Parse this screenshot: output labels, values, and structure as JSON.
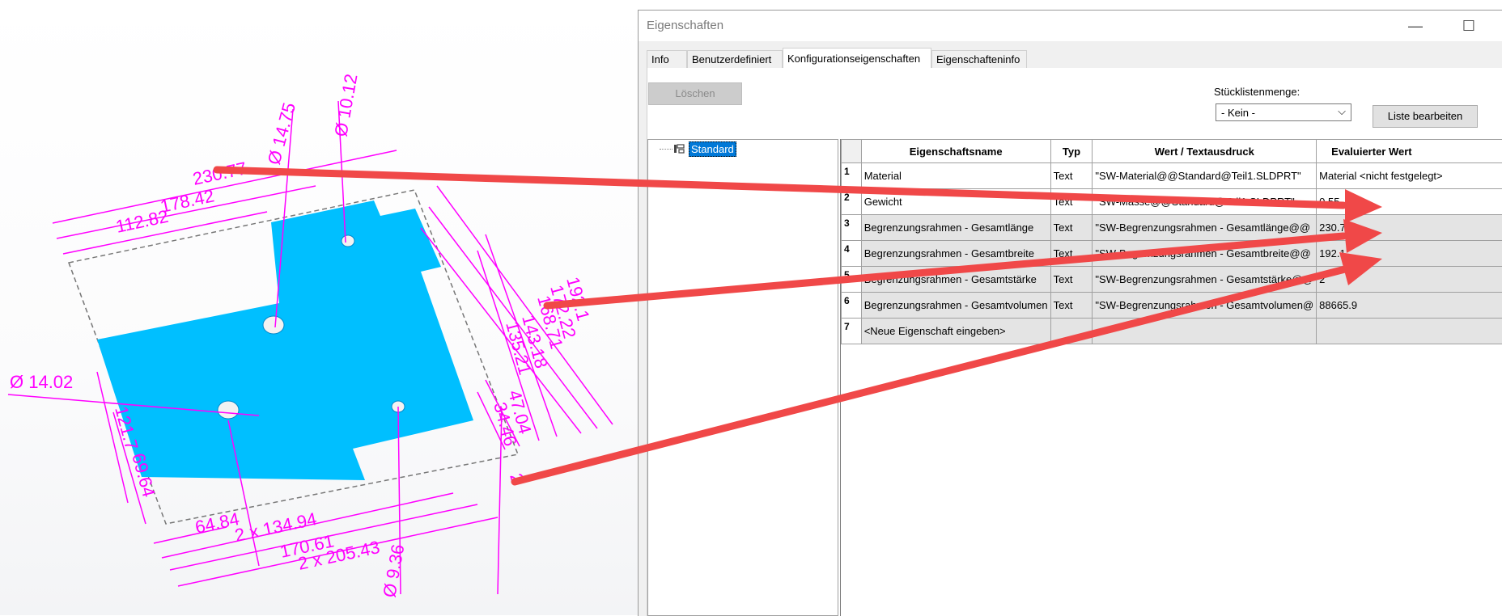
{
  "cad": {
    "dimensions": [
      "Ø 14.75",
      "Ø 10.12",
      "230.77",
      "178.42",
      "112.82",
      "Ø 14.02",
      "192.1",
      "172.22",
      "168.71",
      "143.18",
      "135.21",
      "47.04",
      "34.46",
      "121.7",
      "69.64",
      "64.84",
      "2 x 134.94",
      "170.61",
      "2 x 205.43",
      "Ø 9.36",
      "2"
    ]
  },
  "dialog": {
    "title": "Eigenschaften",
    "window_buttons": {
      "minimize": "—",
      "maximize": "☐",
      "close": "✕"
    },
    "tabs": [
      {
        "label": "Info"
      },
      {
        "label": "Benutzerdefiniert"
      },
      {
        "label": "Konfigurationseigenschaften",
        "active": true
      },
      {
        "label": "Eigenschafteninfo"
      }
    ],
    "delete_label": "Löschen",
    "bom_label": "Stücklistenmenge:",
    "bom_value": "- Kein -",
    "edit_list_label": "Liste bearbeiten",
    "tree": {
      "config_name": "Standard"
    },
    "grid": {
      "headers": [
        "Eigenschaftsname",
        "Typ",
        "Wert / Textausdruck",
        "Evaluierter Wert"
      ],
      "rows": [
        {
          "num": "1",
          "name": "Material",
          "type": "Text",
          "expr": "\"SW-Material@@Standard@Teil1.SLDPRT\"",
          "value": "Material <nicht festgelegt>"
        },
        {
          "num": "2",
          "name": "Gewicht",
          "type": "Text",
          "expr": "\"SW-Masse@@Standard@Teil1.SLDPRT\"",
          "value": "0.55"
        },
        {
          "num": "3",
          "name": "Begrenzungsrahmen - Gesamtlänge",
          "type": "Text",
          "expr": "\"SW-Begrenzungsrahmen - Gesamtlänge@@",
          "value": "230.77"
        },
        {
          "num": "4",
          "name": "Begrenzungsrahmen - Gesamtbreite",
          "type": "Text",
          "expr": "\"SW-Begrenzungsrahmen - Gesamtbreite@@",
          "value": "192.1"
        },
        {
          "num": "5",
          "name": "Begrenzungsrahmen - Gesamtstärke",
          "type": "Text",
          "expr": "\"SW-Begrenzungsrahmen - Gesamtstärke@@",
          "value": "2"
        },
        {
          "num": "6",
          "name": "Begrenzungsrahmen - Gesamtvolumen",
          "type": "Text",
          "expr": "\"SW-Begrenzungsrahmen - Gesamtvolumen@",
          "value": "88665.9"
        },
        {
          "num": "7",
          "name": "<Neue Eigenschaft eingeben>",
          "type": "",
          "expr": "",
          "value": ""
        }
      ]
    }
  },
  "colors": {
    "part_fill": "#00bfff",
    "dimension": "#ff00ff",
    "arrow": "#f04848",
    "selection": "#0078d7"
  }
}
